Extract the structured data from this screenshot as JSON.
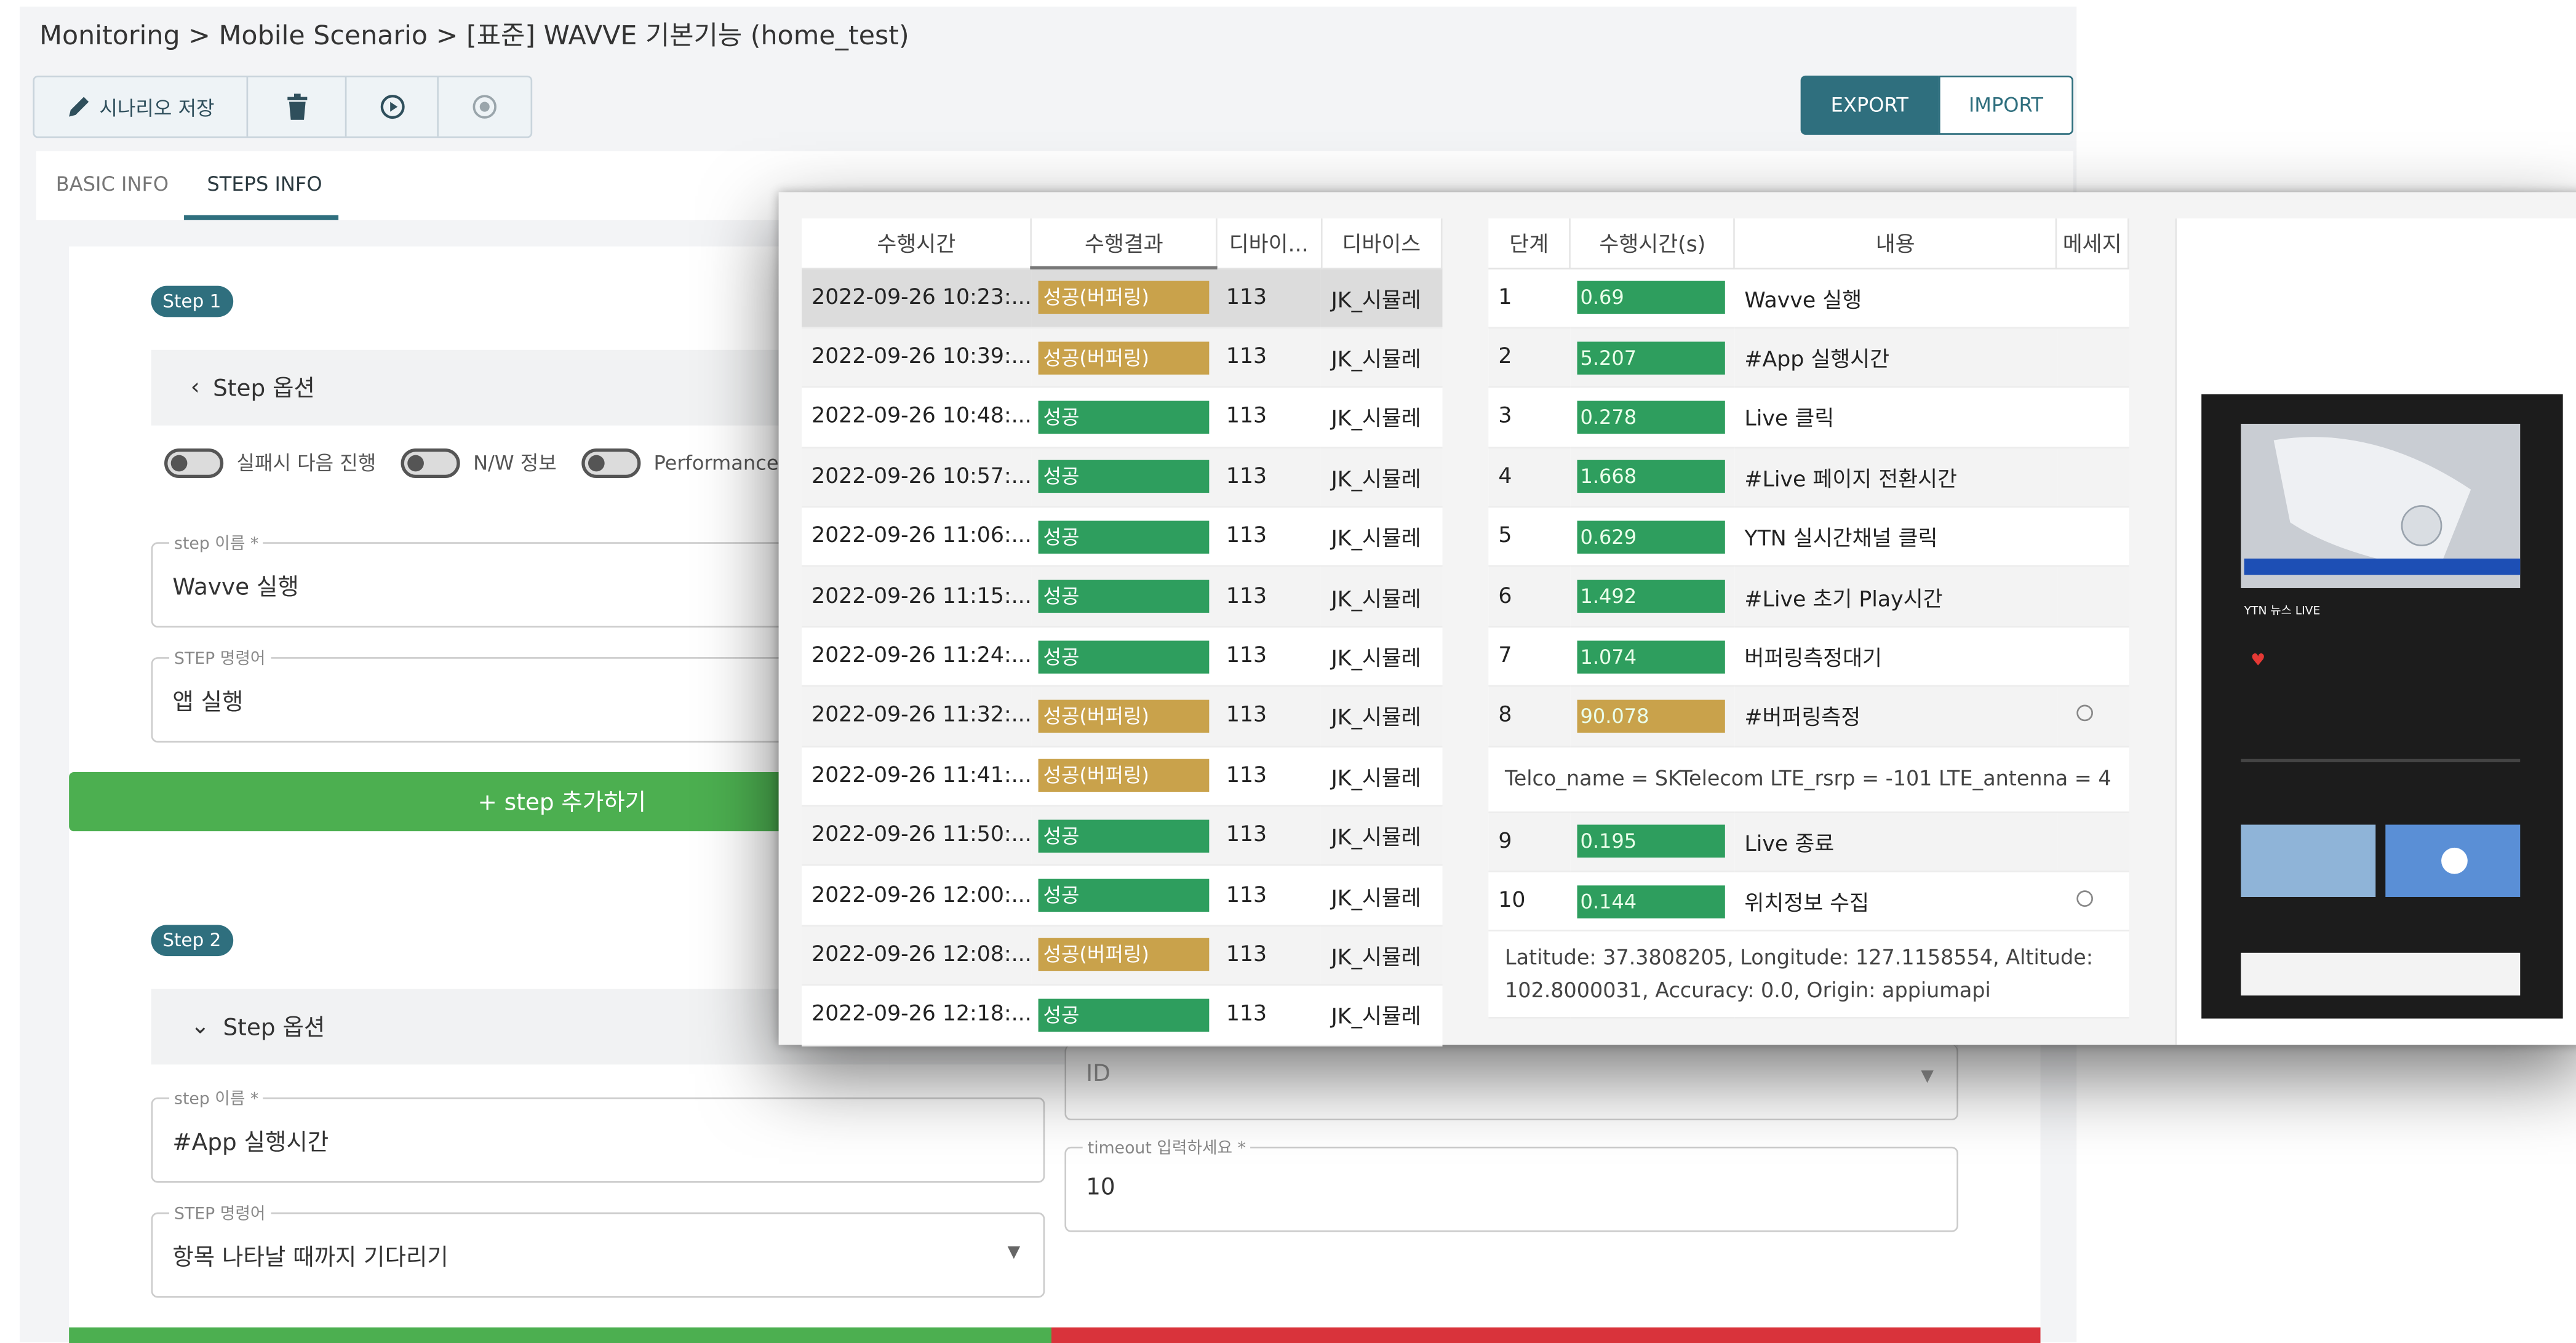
{
  "breadcrumb": {
    "part1": "Monitoring",
    "sep1": ">",
    "part2": "Mobile Scenario",
    "sep2": ">",
    "part3": "[표준] WAVVE 기본기능 (home_test)"
  },
  "toolbar": {
    "save_label": "시나리오 저장",
    "save_icon": "pencil-icon",
    "delete_icon": "trash-icon",
    "play_icon": "play-circle-icon",
    "stop_icon": "stop-circle-icon"
  },
  "actions": {
    "export": "EXPORT",
    "import": "IMPORT"
  },
  "tabs": {
    "basic": "BASIC INFO",
    "steps": "STEPS INFO"
  },
  "step1": {
    "badge": "Step 1",
    "options_label": "Step 옵션",
    "toggles": [
      "실패시 다음 진행",
      "N/W 정보",
      "Performance 정"
    ],
    "name_label": "step 이름 *",
    "name_value": "Wavve 실행",
    "cmd_label": "STEP 명령어",
    "cmd_value": "앱 실행"
  },
  "add_step": "+ step 추가하기",
  "step2": {
    "badge": "Step 2",
    "options_label": "Step 옵션",
    "name_label": "step 이름 *",
    "name_value": "#App 실행시간",
    "cmd_label": "STEP 명령어",
    "cmd_value": "항목 나타날 때까지 기다리기",
    "id_value": "ID",
    "timeout_label": "timeout 입력하세요 *",
    "timeout_value": "10"
  },
  "results_table": {
    "headers": [
      "수행시간",
      "수행결과",
      "디바이...",
      "디바이스"
    ],
    "rows": [
      {
        "time": "2022-09-26 10:23:...",
        "result": "성공(버퍼링)",
        "status": "buf",
        "device_id": "113",
        "device": "JK_시뮬레"
      },
      {
        "time": "2022-09-26 10:39:...",
        "result": "성공(버퍼링)",
        "status": "buf",
        "device_id": "113",
        "device": "JK_시뮬레"
      },
      {
        "time": "2022-09-26 10:48:...",
        "result": "성공",
        "status": "ok",
        "device_id": "113",
        "device": "JK_시뮬레"
      },
      {
        "time": "2022-09-26 10:57:...",
        "result": "성공",
        "status": "ok",
        "device_id": "113",
        "device": "JK_시뮬레"
      },
      {
        "time": "2022-09-26 11:06:...",
        "result": "성공",
        "status": "ok",
        "device_id": "113",
        "device": "JK_시뮬레"
      },
      {
        "time": "2022-09-26 11:15:...",
        "result": "성공",
        "status": "ok",
        "device_id": "113",
        "device": "JK_시뮬레"
      },
      {
        "time": "2022-09-26 11:24:...",
        "result": "성공",
        "status": "ok",
        "device_id": "113",
        "device": "JK_시뮬레"
      },
      {
        "time": "2022-09-26 11:32:...",
        "result": "성공(버퍼링)",
        "status": "buf",
        "device_id": "113",
        "device": "JK_시뮬레"
      },
      {
        "time": "2022-09-26 11:41:...",
        "result": "성공(버퍼링)",
        "status": "buf",
        "device_id": "113",
        "device": "JK_시뮬레"
      },
      {
        "time": "2022-09-26 11:50:...",
        "result": "성공",
        "status": "ok",
        "device_id": "113",
        "device": "JK_시뮬레"
      },
      {
        "time": "2022-09-26 12:00:...",
        "result": "성공",
        "status": "ok",
        "device_id": "113",
        "device": "JK_시뮬레"
      },
      {
        "time": "2022-09-26 12:08:...",
        "result": "성공(버퍼링)",
        "status": "buf",
        "device_id": "113",
        "device": "JK_시뮬레"
      },
      {
        "time": "2022-09-26 12:18:...",
        "result": "성공",
        "status": "ok",
        "device_id": "113",
        "device": "JK_시뮬레"
      }
    ]
  },
  "steps_table": {
    "headers": [
      "단계",
      "수행시간(s)",
      "내용",
      "메세지"
    ],
    "rows": [
      {
        "step": "1",
        "time": "0.69",
        "bar": "g",
        "content": "Wavve 실행"
      },
      {
        "step": "2",
        "time": "5.207",
        "bar": "g",
        "content": "#App 실행시간"
      },
      {
        "step": "3",
        "time": "0.278",
        "bar": "g",
        "content": "Live 클릭"
      },
      {
        "step": "4",
        "time": "1.668",
        "bar": "g",
        "content": "#Live 페이지 전환시간"
      },
      {
        "step": "5",
        "time": "0.629",
        "bar": "g",
        "content": "YTN 실시간채널 클릭"
      },
      {
        "step": "6",
        "time": "1.492",
        "bar": "g",
        "content": "#Live 초기 Play시간"
      },
      {
        "step": "7",
        "time": "1.074",
        "bar": "g",
        "content": "버퍼링측정대기"
      },
      {
        "step": "8",
        "time": "90.078",
        "bar": "y",
        "content": "#버퍼링측정",
        "has_msg": true,
        "msg": "Telco_name = SKTelecom LTE_rsrp = -101 LTE_antenna = 4"
      },
      {
        "step": "9",
        "time": "0.195",
        "bar": "g",
        "content": "Live 종료"
      },
      {
        "step": "10",
        "time": "0.144",
        "bar": "g",
        "content": "위치정보 수집",
        "has_msg": true,
        "msg": "Latitude: 37.3808205, Longitude: 127.1158554, Altitude: 102.8000031, Accuracy: 0.0, Origin: appiumapi"
      }
    ]
  },
  "phone": {
    "channel": "YTN 뉴스 LIVE",
    "headline": "..."
  }
}
